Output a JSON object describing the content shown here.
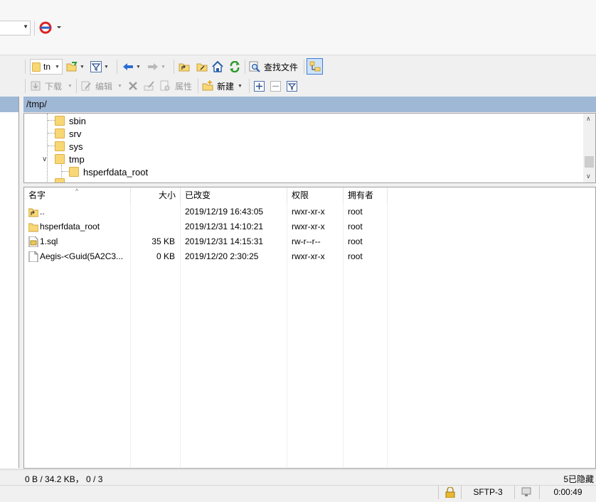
{
  "toolbar": {
    "remote_combo_value": "tn",
    "find_files_label": "查找文件",
    "download_label": "下载",
    "edit_label": "编辑",
    "properties_label": "属性",
    "new_label": "新建"
  },
  "remote": {
    "path": "/tmp/",
    "tree": [
      {
        "name": "sbin"
      },
      {
        "name": "srv"
      },
      {
        "name": "sys"
      },
      {
        "name": "tmp",
        "expanded": true
      },
      {
        "name": "hsperfdata_root",
        "child": true
      }
    ],
    "columns": {
      "name": "名字",
      "size": "大小",
      "modified": "已改变",
      "rights": "权限",
      "owner": "拥有者"
    },
    "files": [
      {
        "name": "..",
        "size": "",
        "modified": "2019/12/19 16:43:05",
        "rights": "rwxr-xr-x",
        "owner": "root",
        "icon": "parent-folder-icon"
      },
      {
        "name": "hsperfdata_root",
        "size": "",
        "modified": "2019/12/31 14:10:21",
        "rights": "rwxr-xr-x",
        "owner": "root",
        "icon": "folder-icon"
      },
      {
        "name": "1.sql",
        "size": "35 KB",
        "modified": "2019/12/31 14:15:31",
        "rights": "rw-r--r--",
        "owner": "root",
        "icon": "sql-file-icon"
      },
      {
        "name": "Aegis-<Guid(5A2C3...",
        "size": "0 KB",
        "modified": "2019/12/20 2:30:25",
        "rights": "rwxr-xr-x",
        "owner": "root",
        "icon": "file-icon"
      }
    ]
  },
  "status": {
    "selection": "0 B / 34.2 KB， 0 / 3",
    "hidden": "5已隐藏",
    "protocol": "SFTP-3",
    "elapsed": "0:00:49"
  },
  "colors": {
    "path_bar": "#9fb8d6",
    "folder": "#f8d775"
  }
}
